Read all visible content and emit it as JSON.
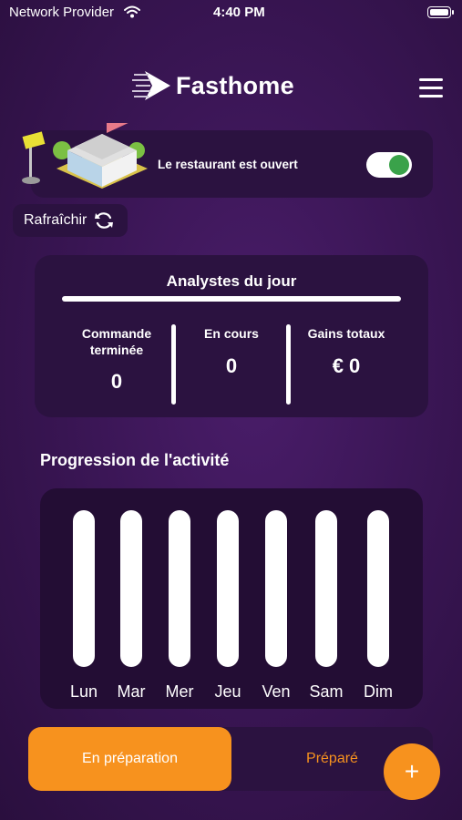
{
  "status_bar": {
    "carrier": "Network Provider",
    "time": "4:40 PM"
  },
  "header": {
    "app_name": "Fasthome"
  },
  "restaurant": {
    "status_label": "Le restaurant est ouvert",
    "open": true
  },
  "refresh": {
    "label": "Rafraîchir"
  },
  "stats": {
    "title": "Analystes du jour",
    "columns": [
      {
        "label": "Commande terminée",
        "value": "0"
      },
      {
        "label": "En cours",
        "value": "0"
      },
      {
        "label": "Gains totaux",
        "value": "€ 0"
      }
    ]
  },
  "activity": {
    "title": "Progression de l'activité",
    "days": [
      "Lun",
      "Mar",
      "Mer",
      "Jeu",
      "Ven",
      "Sam",
      "Dim"
    ]
  },
  "tabs": {
    "active": "En préparation",
    "inactive": "Préparé"
  },
  "fab": {
    "label": "+"
  },
  "colors": {
    "accent": "#f7921e",
    "toggle_on": "#3aa24a",
    "card": "#2b1240"
  }
}
